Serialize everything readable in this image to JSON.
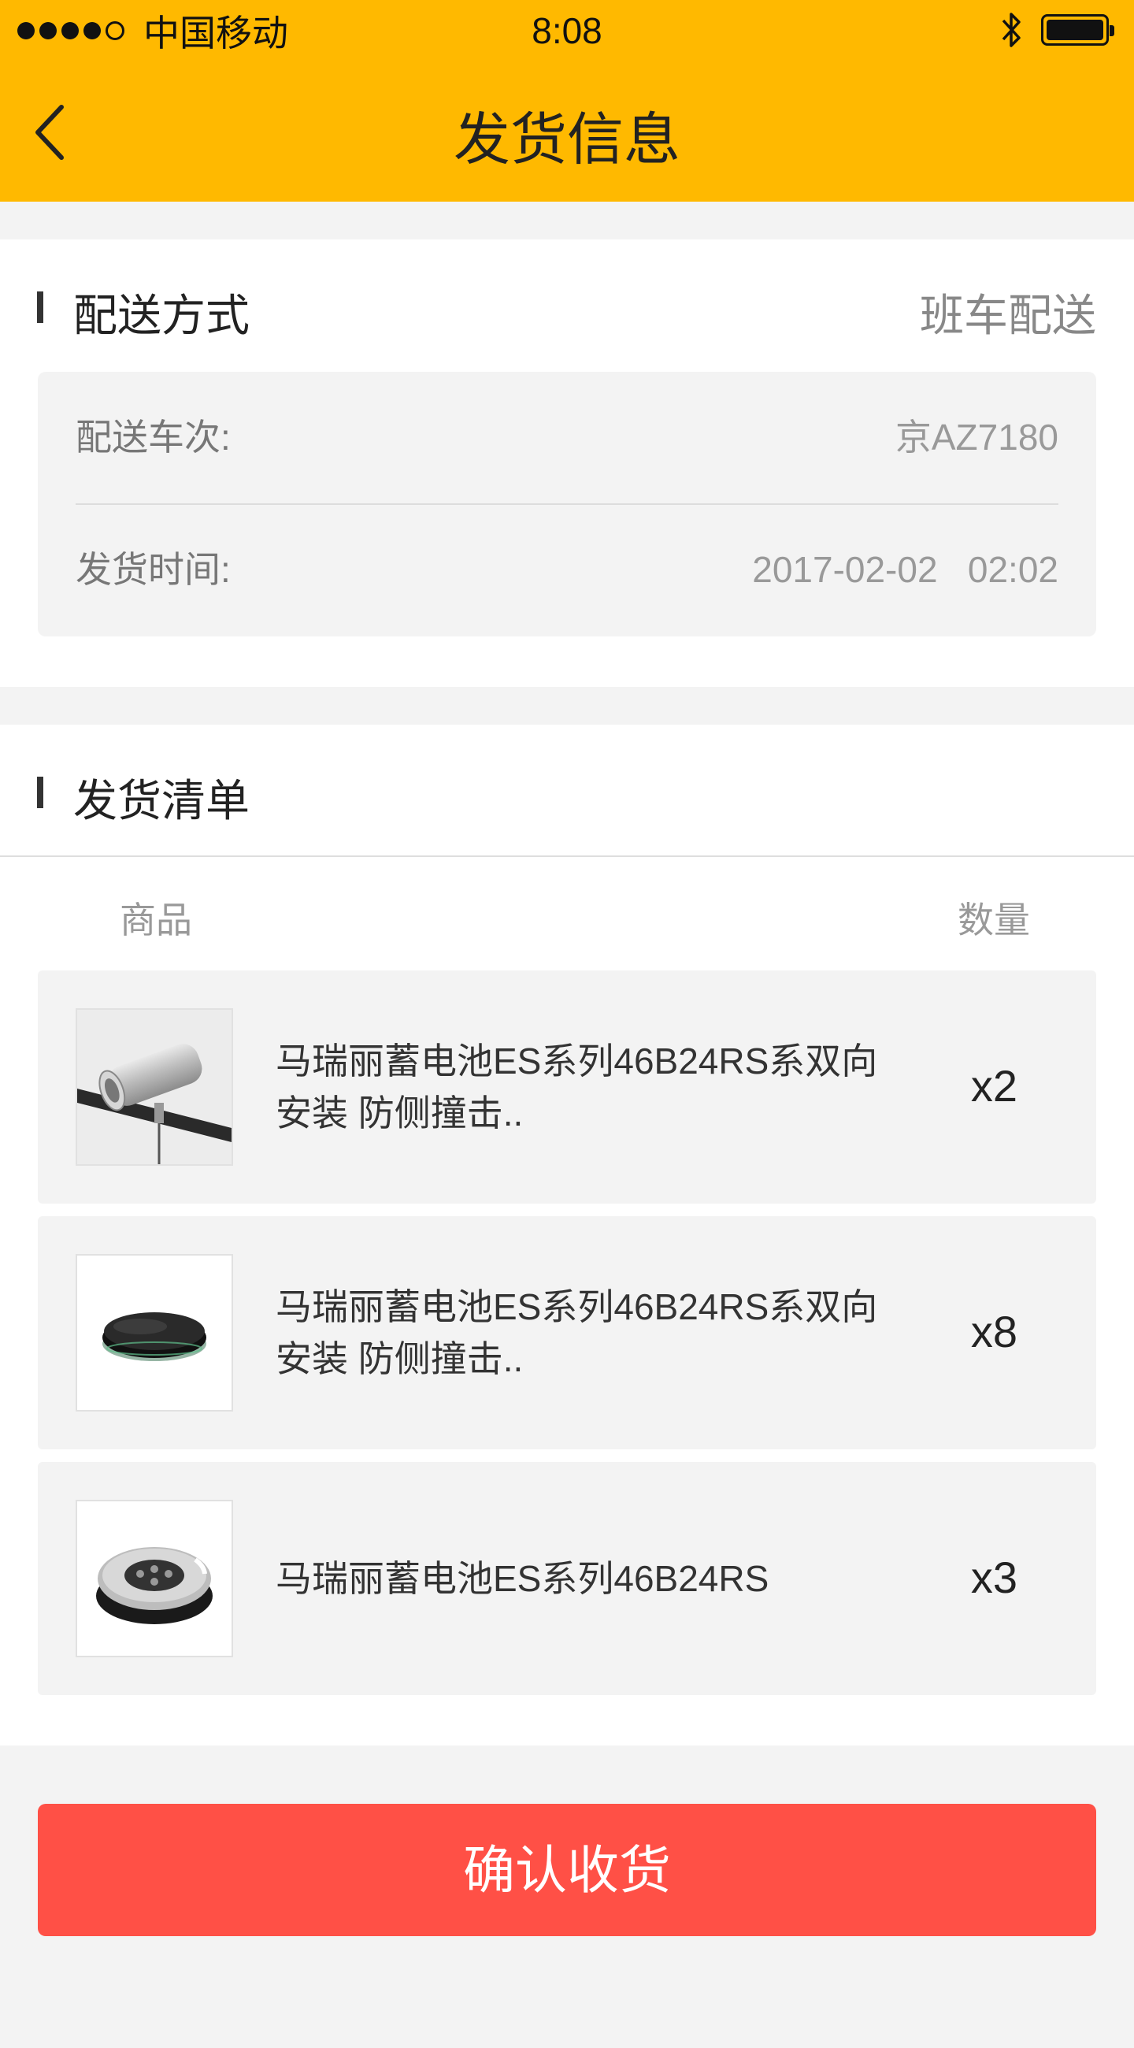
{
  "status_bar": {
    "carrier": "中国移动",
    "time": "8:08"
  },
  "nav": {
    "title": "发货信息"
  },
  "delivery": {
    "title": "配送方式",
    "method": "班车配送",
    "rows": [
      {
        "label": "配送车次:",
        "value": "京AZ7180"
      },
      {
        "label": "发货时间:",
        "value": "2017-02-02   02:02"
      }
    ]
  },
  "shipping_list": {
    "title": "发货清单",
    "col_product": "商品",
    "col_qty": "数量",
    "items": [
      {
        "name": "马瑞丽蓄电池ES系列46B24RS系双向安装 防侧撞击..",
        "qty": "x2",
        "image_icon": "silver-camera-on-rail-icon"
      },
      {
        "name": "马瑞丽蓄电池ES系列46B24RS系双向安装 防侧撞击..",
        "qty": "x8",
        "image_icon": "round-black-hub-icon"
      },
      {
        "name": "马瑞丽蓄电池ES系列46B24RS",
        "qty": "x3",
        "image_icon": "round-speaker-puck-icon"
      }
    ]
  },
  "actions": {
    "confirm_label": "确认收货"
  },
  "colors": {
    "header": "#ffb900",
    "confirm": "#ff5046"
  }
}
